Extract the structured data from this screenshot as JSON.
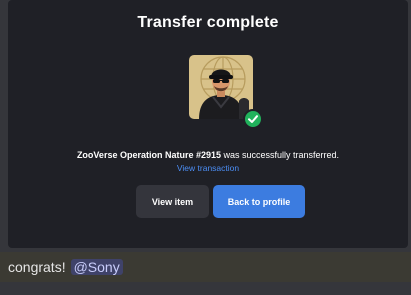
{
  "dialog": {
    "title": "Transfer complete",
    "item_name": "ZooVerse Operation Nature #2915",
    "message_suffix": " was successfully transferred.",
    "view_transaction_label": "View transaction",
    "view_item_label": "View item",
    "back_to_profile_label": "Back to profile",
    "status": "success"
  },
  "chat": {
    "message": "congrats!",
    "mention": "@Sony"
  },
  "colors": {
    "dialog_bg": "#1f2026",
    "primary_button": "#3c7ce0",
    "secondary_button": "#34353c",
    "success": "#21b25c",
    "link": "#4c8ef5",
    "mention_bg": "#3f4269"
  },
  "icons": {
    "nft": "nft-thumbnail",
    "status": "check-circle-icon"
  }
}
